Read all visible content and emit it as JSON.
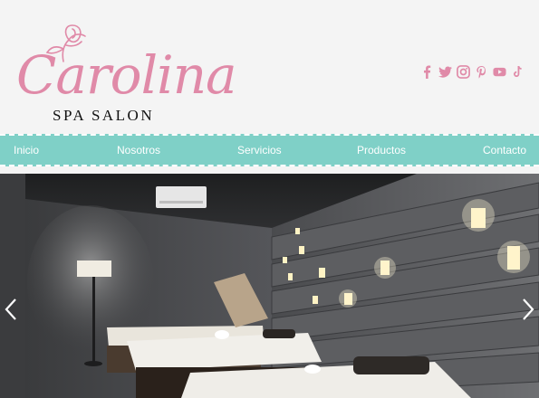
{
  "brand": {
    "name": "Carolina",
    "tagline": "SPA SALON",
    "color": "#e08aa8"
  },
  "social": [
    "facebook-icon",
    "twitter-icon",
    "instagram-icon",
    "pinterest-icon",
    "youtube-icon",
    "tiktok-icon"
  ],
  "nav": {
    "color": "#7fd0c7",
    "items": [
      {
        "label": "Inicio"
      },
      {
        "label": "Nosotros"
      },
      {
        "label": "Servicios"
      },
      {
        "label": "Productos"
      },
      {
        "label": "Contacto"
      }
    ]
  },
  "hero": {
    "controls": [
      "chevron-left-icon",
      "chevron-right-icon"
    ]
  }
}
